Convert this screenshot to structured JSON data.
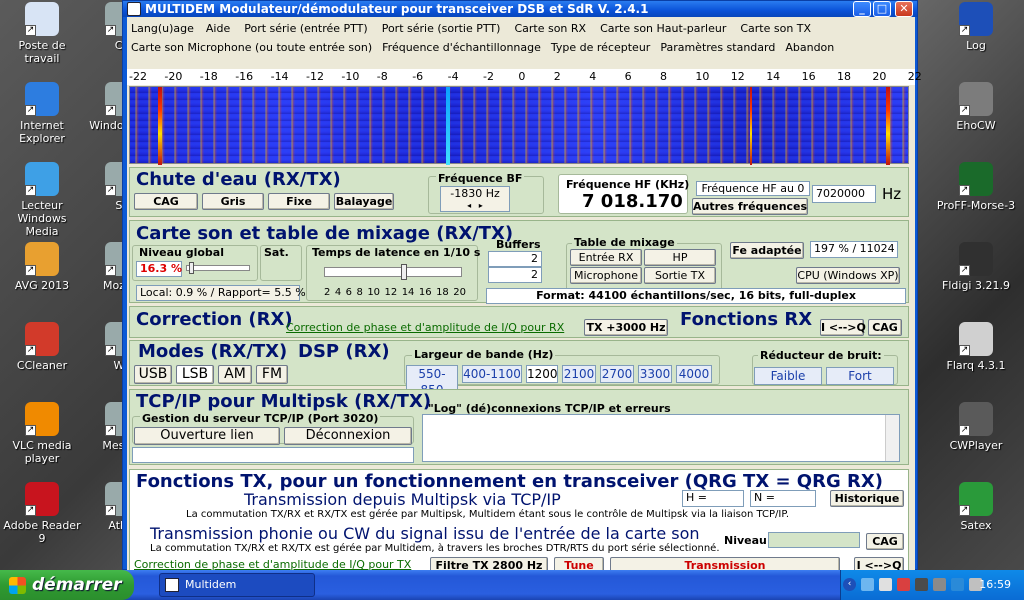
{
  "desktop": {
    "left_icons": [
      {
        "label": "Poste de travail",
        "icon": "computer-icon",
        "color": "#d8e4f5"
      },
      {
        "label": "Internet Explorer",
        "icon": "ie-icon",
        "color": "#2d7de0"
      },
      {
        "label": "Lecteur Windows Media",
        "icon": "media-player-icon",
        "color": "#3ea0e6"
      },
      {
        "label": "AVG 2013",
        "icon": "avg-icon",
        "color": "#e8a030"
      },
      {
        "label": "CCleaner",
        "icon": "ccleaner-icon",
        "color": "#d23a2a"
      },
      {
        "label": "VLC media player",
        "icon": "vlc-icon",
        "color": "#f08a00"
      },
      {
        "label": "Adobe Reader 9",
        "icon": "adobe-reader-icon",
        "color": "#c8141e"
      }
    ],
    "mid_icons": [
      {
        "label": "Co",
        "icon": "shortcut-icon"
      },
      {
        "label": "Windo Mess",
        "icon": "messenger-icon"
      },
      {
        "label": "Sk",
        "icon": "shortcut-icon"
      },
      {
        "label": "Mozilla",
        "icon": "firefox-icon"
      },
      {
        "label": "Wo",
        "icon": "shortcut-icon"
      },
      {
        "label": "Mes do",
        "icon": "folder-icon"
      },
      {
        "label": "Atlas",
        "icon": "shortcut-icon"
      }
    ],
    "right_icons": [
      {
        "label": "Log",
        "icon": "globe-icon",
        "color": "#1d4fb8"
      },
      {
        "label": "EhoCW",
        "icon": "app-icon",
        "color": "#7c7c7c"
      },
      {
        "label": "ProFF-Morse-3",
        "icon": "morse-icon",
        "color": "#1a6a2a"
      },
      {
        "label": "Fldigi 3.21.9",
        "icon": "fldigi-icon",
        "color": "#303030"
      },
      {
        "label": "Flarq 4.3.1",
        "icon": "flarq-icon",
        "color": "#d0d0d0"
      },
      {
        "label": "CWPlayer",
        "icon": "cwplayer-icon",
        "color": "#5a5a5a"
      },
      {
        "label": "Satex",
        "icon": "satex-icon",
        "color": "#2a9a3a"
      }
    ]
  },
  "window": {
    "title": "MULTIDEM Modulateur/démodulateur pour transceiver DSB et SdR  V. 2.4.1",
    "menu_row1": [
      "Lang(u)age",
      "Aide",
      "Port série (entrée PTT)",
      "Port série (sortie PTT)",
      "Carte son RX",
      "Carte son Haut-parleur",
      "Carte son TX"
    ],
    "menu_row2": [
      "Carte son Microphone (ou toute entrée son)",
      "Fréquence d'échantillonnage",
      "Type de récepteur",
      "Paramètres standard",
      "Abandon"
    ],
    "ruler": [
      "-22",
      "-20",
      "-18",
      "-16",
      "-14",
      "-12",
      "-10",
      "-8",
      "-6",
      "-4",
      "-2",
      "0",
      "2",
      "4",
      "6",
      "8",
      "10",
      "12",
      "14",
      "16",
      "18",
      "20",
      "22"
    ],
    "waterfall": {
      "title": "Chute d'eau (RX/TX)",
      "buttons": [
        "CAG",
        "Gris",
        "Fixe",
        "Balayage"
      ],
      "bf_label": "Fréquence BF",
      "bf_value": "-1830 Hz",
      "hf_label": "Fréquence HF (KHz)",
      "hf_value": "7 018.170",
      "hf0_label": "Fréquence HF au 0",
      "other_freq": "Autres fréquences",
      "hf0_value": "7020000",
      "hz": "Hz"
    },
    "mixer": {
      "title": "Carte son et table de mixage (RX/TX)",
      "global_level": "Niveau global",
      "sat": "Sat.",
      "level_value": "16.3 %",
      "latency": "Temps de latence en 1/10 s",
      "latency_ticks": [
        "2",
        "4",
        "6",
        "8",
        "10",
        "12",
        "14",
        "16",
        "18",
        "20"
      ],
      "local": "Local:   0.9 % / Rapport=   5.5 %",
      "buffers": "Buffers",
      "buf1": "2",
      "buf2": "2",
      "mix_table": "Table de mixage",
      "mix_buttons": [
        "Entrée RX",
        "HP",
        "Microphone",
        "Sortie TX"
      ],
      "fe": "Fe adaptée",
      "fe_value": "197 % / 11024",
      "cpu": "CPU (Windows XP)",
      "format": "Format: 44100 échantillons/sec, 16 bits, full-duplex"
    },
    "correction": {
      "title": "Correction (RX)",
      "link": "Correction de phase et d'amplitude de I/Q pour RX",
      "tx_btn": "TX +3000 Hz",
      "fonctions": "Fonctions RX",
      "iq": "I <-->Q",
      "cag": "CAG"
    },
    "modes": {
      "title": "Modes (RX/TX)",
      "buttons": [
        "USB",
        "LSB",
        "AM",
        "FM"
      ],
      "dsp": "DSP (RX)",
      "bw_label": "Largeur de bande (Hz)",
      "bandwidths": [
        "550-850",
        "400-1100",
        "1200",
        "2100",
        "2700",
        "3300",
        "4000"
      ],
      "nr_label": "Réducteur de bruit:",
      "nr": [
        "Faible",
        "Fort"
      ]
    },
    "tcp": {
      "title": "TCP/IP pour Multipsk (RX/TX)",
      "server": "Gestion du serveur TCP/IP (Port 3020)",
      "open": "Ouverture lien",
      "close": "Déconnexion",
      "log": "\"Log\" (dé)connexions TCP/IP et erreurs"
    },
    "tx": {
      "title": "Fonctions TX, pour un fonctionnement en transceiver (QRG TX = QRG RX)",
      "multipsk": "Transmission depuis Multipsk via TCP/IP",
      "multipsk_note": "La commutation TX/RX et RX/TX est gérée par Multipsk, Multidem étant sous le contrôle de Multipsk via la liaison TCP/IP.",
      "h": "H  =",
      "n": "N  =",
      "historique": "Historique",
      "phonie": "Transmission phonie ou CW du signal issu de l'entrée de la carte son",
      "phonie_note": "La commutation TX/RX et RX/TX est gérée par Multidem, à travers les broches DTR/RTS du port série sélectionné.",
      "niveau": "Niveau:",
      "cag": "CAG",
      "bottom": [
        "Correction de phase et d'amplitude de I/Q pour TX",
        "Filtre TX 2800 Hz",
        "Tune",
        "Transmission",
        "I <-->Q"
      ]
    }
  },
  "taskbar": {
    "start": "démarrer",
    "app": "Multidem",
    "clock": "16:59"
  }
}
